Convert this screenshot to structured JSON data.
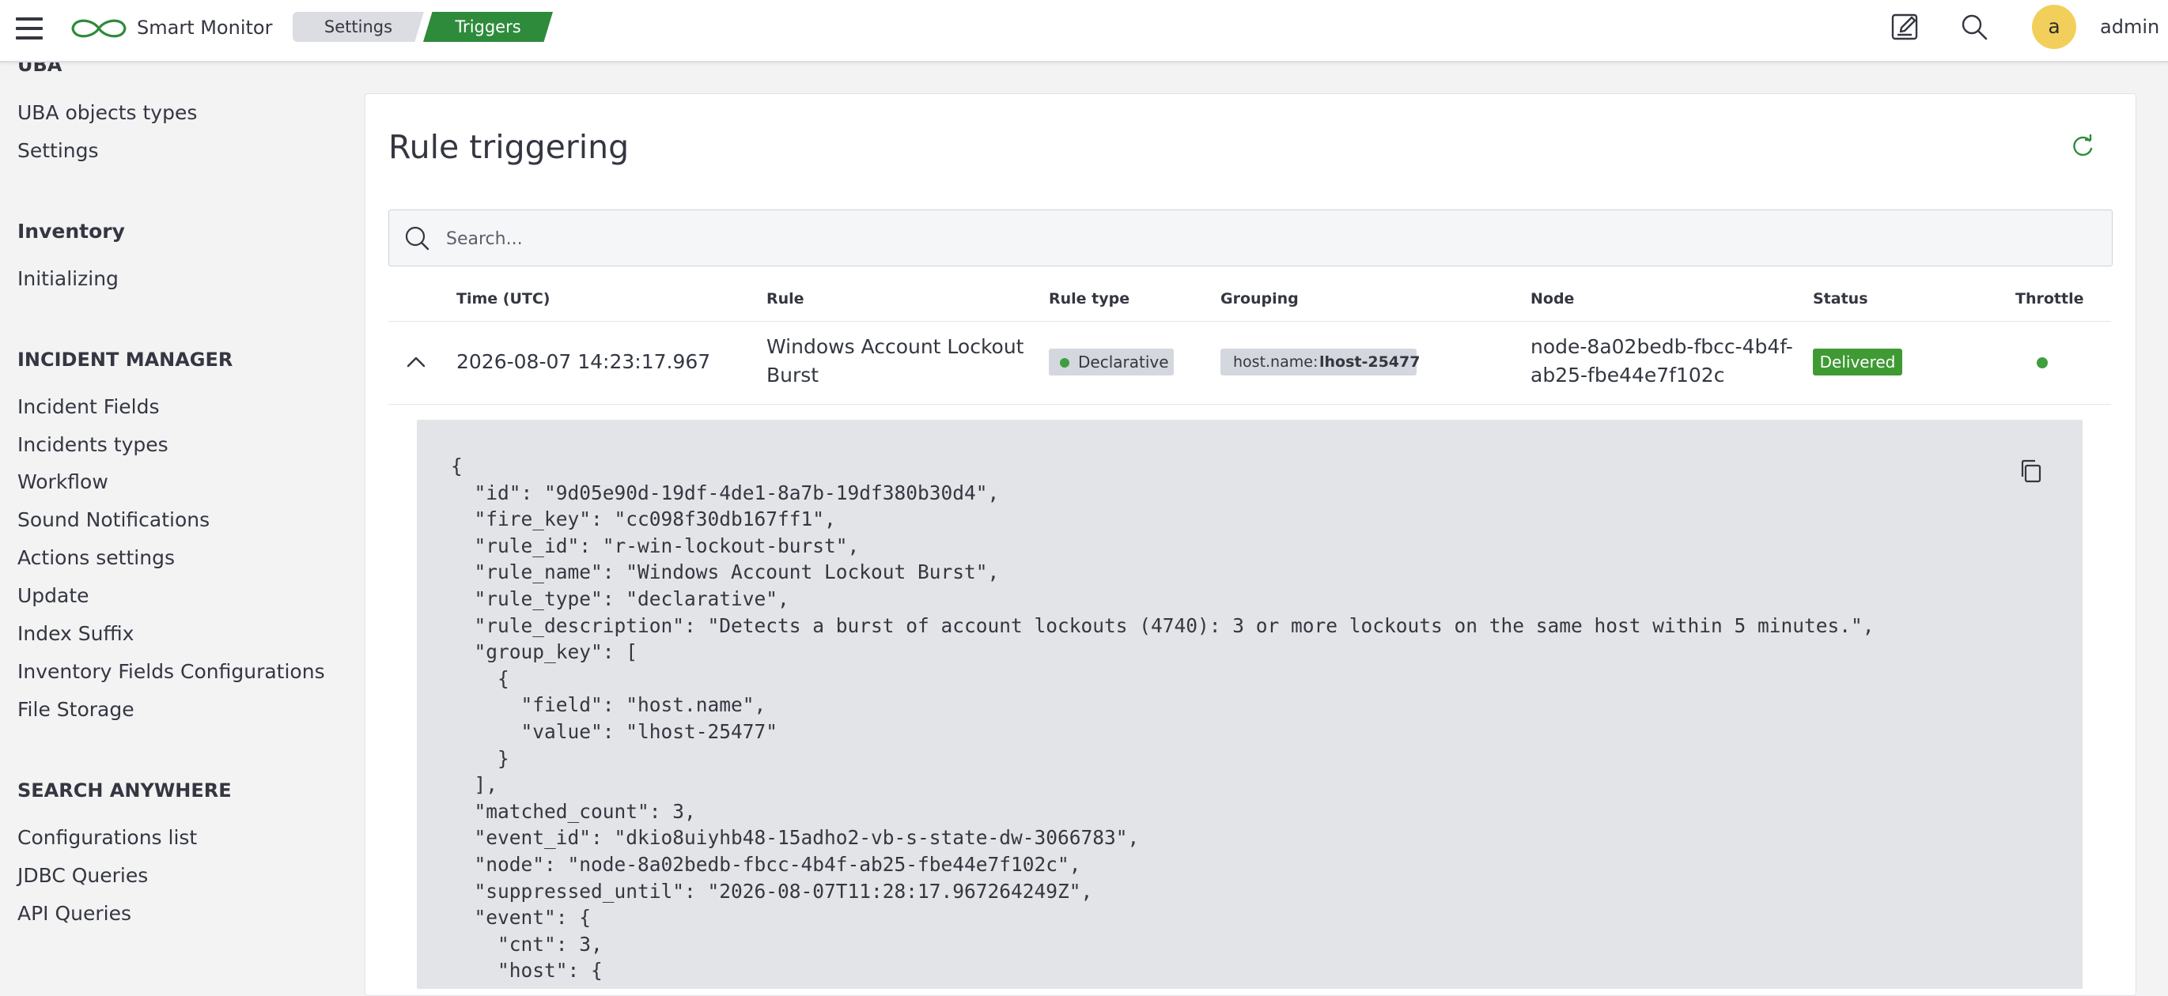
{
  "topbar": {
    "brand": "Smart Monitor",
    "breadcrumb": [
      "Settings",
      "Triggers"
    ],
    "avatar_letter": "a",
    "username": "admin",
    "icons": [
      "menu-icon",
      "infinity-logo-icon",
      "edit-icon",
      "search-icon"
    ]
  },
  "sidebar": {
    "uba_heading": "UBA",
    "uba_items": [
      "UBA objects types",
      "Settings"
    ],
    "inventory_heading": "Inventory",
    "inventory_items": [
      "Initializing"
    ],
    "incident_heading": "INCIDENT MANAGER",
    "incident_items": [
      "Incident Fields",
      "Incidents types",
      "Workflow",
      "Sound Notifications",
      "Actions settings",
      "Update",
      "Index Suffix",
      "Inventory Fields Configurations",
      "File Storage"
    ],
    "search_heading": "SEARCH ANYWHERE",
    "search_items": [
      "Configurations list",
      "JDBC Queries",
      "API Queries"
    ]
  },
  "main": {
    "title": "Rule triggering",
    "search_placeholder": "Search...",
    "columns": [
      "Time (UTC)",
      "Rule",
      "Rule type",
      "Grouping",
      "Node",
      "Status",
      "Throttle"
    ],
    "row": {
      "time": "2026-08-07 14:23:17.967",
      "rule_line1": "Windows Account Lockout",
      "rule_line2": "Burst",
      "rule_type": "Declarative",
      "grouping_key": "host.name:",
      "grouping_value": "lhost-25477",
      "node_line1": "node-8a02bedb-fbcc-4b4f-",
      "node_line2": "ab25-fbe44e7f102c",
      "status": "Delivered",
      "status_color": "#3f9a33",
      "throttle_color": "#3f9e3f"
    },
    "json_lines": [
      "{",
      "  \"id\": \"9d05e90d-19df-4de1-8a7b-19df380b30d4\",",
      "  \"fire_key\": \"cc098f30db167ff1\",",
      "  \"rule_id\": \"r-win-lockout-burst\",",
      "  \"rule_name\": \"Windows Account Lockout Burst\",",
      "  \"rule_type\": \"declarative\",",
      "  \"rule_description\": \"Detects a burst of account lockouts (4740): 3 or more lockouts on the same host within 5 minutes.\",",
      "  \"group_key\": [",
      "    {",
      "      \"field\": \"host.name\",",
      "      \"value\": \"lhost-25477\"",
      "    }",
      "  ],",
      "  \"matched_count\": 3,",
      "  \"event_id\": \"dkio8uiyhb48-15adho2-vb-s-state-dw-3066783\",",
      "  \"node\": \"node-8a02bedb-fbcc-4b4f-ab25-fbe44e7f102c\",",
      "  \"suppressed_until\": \"2026-08-07T11:28:17.967264249Z\",",
      "  \"event\": {",
      "    \"cnt\": 3,",
      "    \"host\": {"
    ]
  },
  "colors": {
    "accent": "#2e8b3c",
    "badge_gray": "#d4d7dd",
    "json_bg": "#e3e4e7"
  }
}
